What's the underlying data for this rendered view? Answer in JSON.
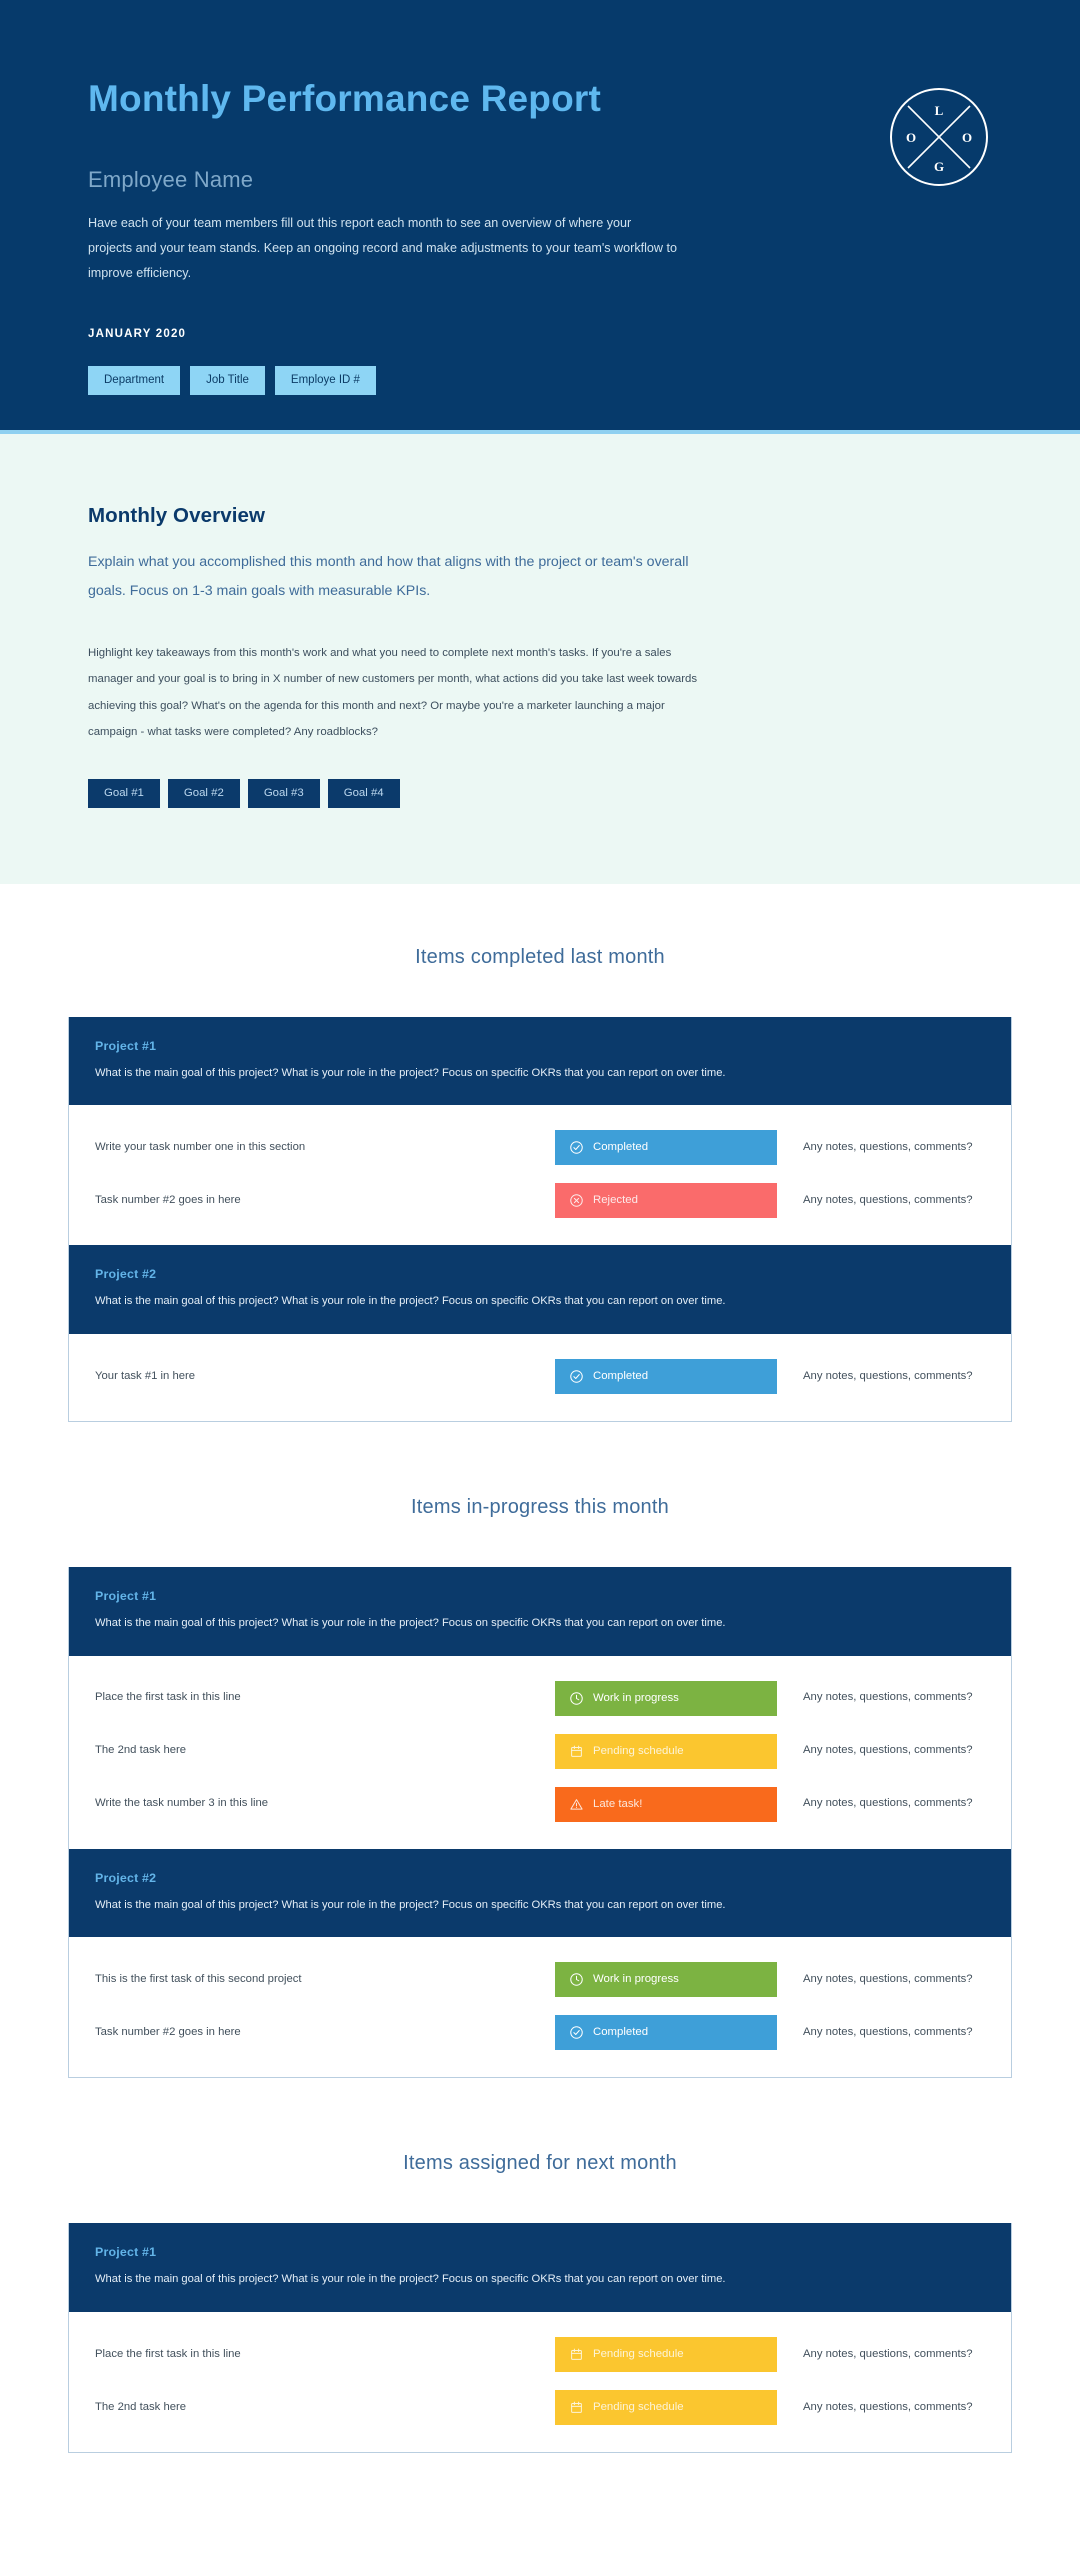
{
  "header": {
    "title": "Monthly Performance Report",
    "employee_name": "Employee Name",
    "description": "Have each of your team members fill out this report each month to see an overview of where your projects and your team stands. Keep an ongoing record and make adjustments to your team's workflow to improve efficiency.",
    "date": "JANUARY 2020",
    "pills": [
      "Department",
      "Job Title",
      "Employe ID #"
    ],
    "logo": {
      "letters": [
        "L",
        "O",
        "G",
        "O"
      ],
      "icon": "logo-circle-x-icon"
    },
    "colors": {
      "background": "#063a6b",
      "title": "#5fb8ef",
      "pill_bg": "#8ed5f5",
      "divider": "#8fd0f0"
    }
  },
  "overview": {
    "title": "Monthly Overview",
    "lead": "Explain what you accomplished this month and how that aligns with the project or team's overall goals. Focus on 1-3 main goals with measurable KPIs.",
    "body": "Highlight key takeaways from this month's work and what you need to complete next month's tasks. If you're a sales manager and your goal is to bring in X number of new customers per month, what actions did you take last week towards achieving this goal? What's on the agenda for this month and next? Or maybe you're a marketer launching a major campaign - what tasks were completed? Any roadblocks?",
    "goals": [
      "Goal #1",
      "Goal #2",
      "Goal #3",
      "Goal #4"
    ],
    "colors": {
      "background": "#ecf8f4",
      "title": "#0b3a6b",
      "goal_bg": "#0b3a6b"
    }
  },
  "status_colors": {
    "completed": "#3e9fd8",
    "rejected": "#fa6b6b",
    "work_in_progress": "#7cb342",
    "pending_schedule": "#fbc62f",
    "late_task": "#f96a1c"
  },
  "project_description": "What is the main goal of this project? What is your role in the project? Focus on specific OKRs that you can report on over time.",
  "notes_placeholder": "Any notes, questions, comments?",
  "sections": [
    {
      "heading": "Items completed last month",
      "projects": [
        {
          "name": "Project #1",
          "description": "What is the main goal of this project? What is your role in the project? Focus on specific OKRs that you can report on over time.",
          "tasks": [
            {
              "title": "Write your task number one in this section",
              "status": "Completed",
              "status_key": "completed",
              "icon": "check-circle-icon",
              "notes": "Any notes, questions, comments?"
            },
            {
              "title": "Task number #2 goes in here",
              "status": "Rejected",
              "status_key": "rejected",
              "icon": "x-circle-icon",
              "notes": "Any notes, questions, comments?"
            }
          ]
        },
        {
          "name": "Project #2",
          "description": "What is the main goal of this project? What is your role in the project? Focus on specific OKRs that you can report on over time.",
          "tasks": [
            {
              "title": "Your task #1 in here",
              "status": "Completed",
              "status_key": "completed",
              "icon": "check-circle-icon",
              "notes": "Any notes, questions, comments?"
            }
          ]
        }
      ]
    },
    {
      "heading": "Items in-progress this month",
      "projects": [
        {
          "name": "Project #1",
          "description": "What is the main goal of this project? What is your role in the project? Focus on specific OKRs that you can report on over time.",
          "tasks": [
            {
              "title": "Place the first task in this line",
              "status": "Work in progress",
              "status_key": "work_in_progress",
              "icon": "clock-icon",
              "notes": "Any notes, questions, comments?"
            },
            {
              "title": "The 2nd task here",
              "status": "Pending schedule",
              "status_key": "pending_schedule",
              "icon": "calendar-icon",
              "notes": "Any notes, questions, comments?"
            },
            {
              "title": "Write the task number 3 in this line",
              "status": "Late task!",
              "status_key": "late_task",
              "icon": "warning-triangle-icon",
              "notes": "Any notes, questions, comments?"
            }
          ]
        },
        {
          "name": "Project #2",
          "description": "What is the main goal of this project? What is your role in the project? Focus on specific OKRs that you can report on over time.",
          "tasks": [
            {
              "title": "This is the first task of this second project",
              "status": "Work in progress",
              "status_key": "work_in_progress",
              "icon": "clock-icon",
              "notes": "Any notes, questions, comments?"
            },
            {
              "title": "Task number #2 goes in here",
              "status": "Completed",
              "status_key": "completed",
              "icon": "check-circle-icon",
              "notes": "Any notes, questions, comments?"
            }
          ]
        }
      ]
    },
    {
      "heading": "Items assigned for next month",
      "projects": [
        {
          "name": "Project #1",
          "description": "What is the main goal of this project? What is your role in the project? Focus on specific OKRs that you can report on over time.",
          "tasks": [
            {
              "title": "Place the first task in this line",
              "status": "Pending schedule",
              "status_key": "pending_schedule",
              "icon": "calendar-icon",
              "notes": "Any notes, questions, comments?"
            },
            {
              "title": "The 2nd task here",
              "status": "Pending schedule",
              "status_key": "pending_schedule",
              "icon": "calendar-icon",
              "notes": "Any notes, questions, comments?"
            }
          ]
        }
      ]
    }
  ]
}
